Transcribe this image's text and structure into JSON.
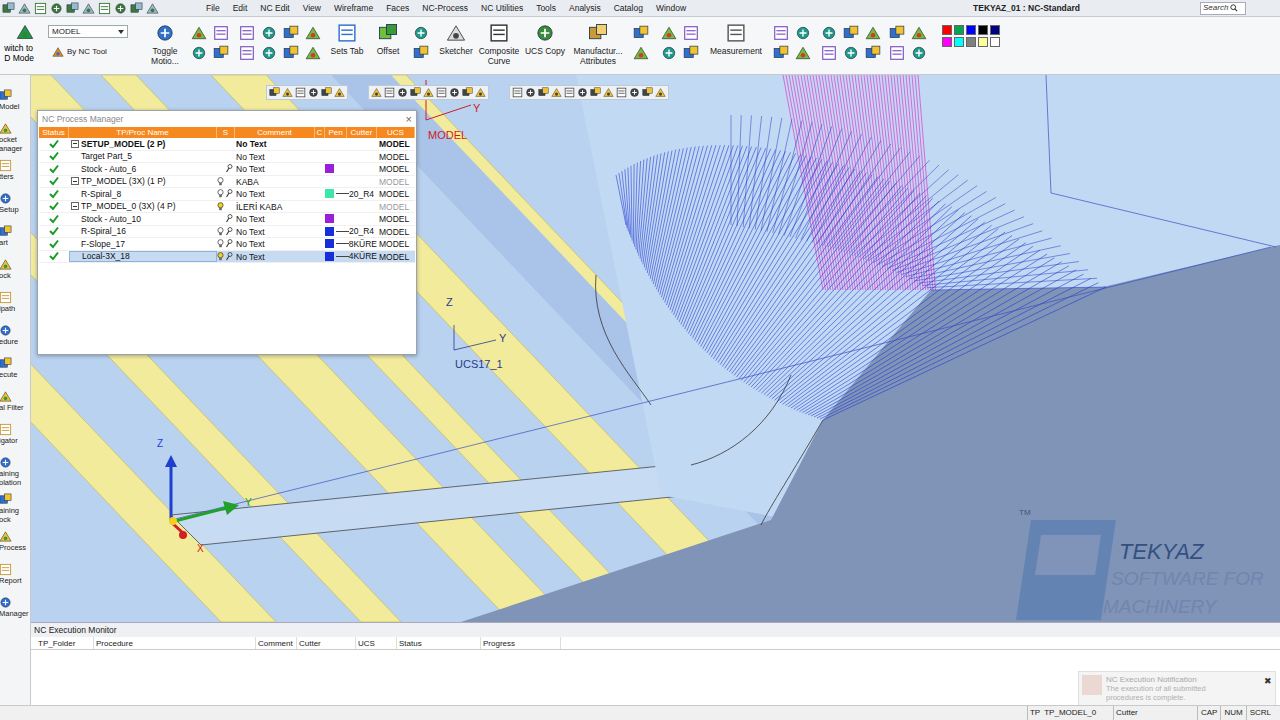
{
  "title_bar": {
    "menu": [
      "File",
      "Edit",
      "NC Edit",
      "View",
      "Wireframe",
      "Faces",
      "NC-Process",
      "NC Utilities",
      "Tools",
      "Analysis",
      "Catalog",
      "Window"
    ],
    "title": "TEKYAZ_01 : NC-Standard",
    "search": {
      "placeholder": "Search"
    }
  },
  "ribbon": {
    "switch_mode": [
      "witch to",
      "D Mode"
    ],
    "model_select": {
      "value": "MODEL"
    },
    "by_nc_tool": "By NC Tool",
    "toggle_motion": [
      "Toggle",
      "Motio..."
    ],
    "sets_tab": [
      "Sets Tab"
    ],
    "offset": [
      "Offset"
    ],
    "sketcher": [
      "Sketcher"
    ],
    "composite_curve": [
      "Composite",
      "Curve"
    ],
    "ucs_copy": [
      "UCS Copy"
    ],
    "manufacturing_attributes": [
      "Manufactur...",
      "Attributes"
    ],
    "measurement": [
      "Measurement"
    ],
    "palette": [
      {
        "color": "#ff0000"
      },
      {
        "color": "#00a651"
      },
      {
        "color": "#0000ff"
      },
      {
        "color": "#000000"
      },
      {
        "color": "#000080"
      },
      {
        "color": "#ff00ff"
      },
      {
        "color": "#00ffff"
      },
      {
        "color": "#808080"
      },
      {
        "color": "#ffff99"
      },
      {
        "color": "#ffffff"
      }
    ]
  },
  "left_toolbar": [
    {
      "lines": [
        "Model"
      ]
    },
    {
      "lines": [
        "ocket",
        "anager"
      ]
    },
    {
      "lines": [
        "tters"
      ]
    },
    {
      "lines": [
        "Setup"
      ]
    },
    {
      "lines": [
        "art"
      ]
    },
    {
      "lines": [
        "ock"
      ]
    },
    {
      "lines": [
        "lpath"
      ]
    },
    {
      "lines": [
        "edure"
      ]
    },
    {
      "lines": [
        "ecute"
      ]
    },
    {
      "lines": [
        "al Filter"
      ]
    },
    {
      "lines": [
        "igator"
      ]
    },
    {
      "lines": [
        "aining",
        "olation"
      ]
    },
    {
      "lines": [
        "aining",
        "ock"
      ]
    },
    {
      "lines": [
        "Process"
      ]
    },
    {
      "lines": [
        "Report"
      ]
    },
    {
      "lines": [
        "Manager"
      ]
    }
  ],
  "process_manager": {
    "title": "NC Process Manager",
    "close": "×",
    "columns": [
      "Status",
      "TP/Proc Name",
      "S",
      "Comment",
      "C",
      "Pen",
      "Cutter",
      "UCS"
    ],
    "rows": [
      {
        "name": "SETUP_MODEL (2 P)",
        "folder": true,
        "expanded": true,
        "bold": true,
        "greyed": false,
        "lamp": false,
        "lamp_lit": false,
        "wrench": false,
        "comment": "No Text",
        "color": "",
        "cutter": "",
        "ucs": "MODEL",
        "selected": false
      },
      {
        "name": "Target Part_5",
        "folder": false,
        "expanded": false,
        "bold": false,
        "greyed": false,
        "lamp": false,
        "lamp_lit": false,
        "wrench": false,
        "comment": "No Text",
        "color": "",
        "cutter": "",
        "ucs": "MODEL",
        "selected": false
      },
      {
        "name": "Stock - Auto_6",
        "folder": false,
        "expanded": false,
        "bold": false,
        "greyed": false,
        "lamp": false,
        "lamp_lit": false,
        "wrench": true,
        "comment": "No Text",
        "color": "#9b1fd6",
        "cutter": "",
        "ucs": "MODEL",
        "selected": false
      },
      {
        "name": "TP_MODEL (3X) (1 P)",
        "folder": true,
        "expanded": true,
        "bold": false,
        "greyed": true,
        "lamp": true,
        "lamp_lit": false,
        "wrench": false,
        "comment": "KABA",
        "color": "",
        "cutter": "",
        "ucs": "MODEL",
        "selected": false
      },
      {
        "name": "R-Spiral_8",
        "folder": false,
        "expanded": false,
        "bold": false,
        "greyed": false,
        "lamp": true,
        "lamp_lit": false,
        "wrench": true,
        "comment": "No Text",
        "color": "#3ee6a8",
        "cutter": "20_R4",
        "ucs": "MODEL",
        "selected": false
      },
      {
        "name": "TP_MODEL_0 (3X) (4 P)",
        "folder": true,
        "expanded": true,
        "bold": false,
        "greyed": true,
        "lamp": true,
        "lamp_lit": true,
        "wrench": false,
        "comment": "İLERİ KABA",
        "color": "",
        "cutter": "",
        "ucs": "MODEL",
        "selected": false
      },
      {
        "name": "Stock - Auto_10",
        "folder": false,
        "expanded": false,
        "bold": false,
        "greyed": false,
        "lamp": false,
        "lamp_lit": false,
        "wrench": true,
        "comment": "No Text",
        "color": "#9b1fd6",
        "cutter": "",
        "ucs": "MODEL",
        "selected": false
      },
      {
        "name": "R-Spiral_16",
        "folder": false,
        "expanded": false,
        "bold": false,
        "greyed": false,
        "lamp": true,
        "lamp_lit": false,
        "wrench": true,
        "comment": "No Text",
        "color": "#1530d8",
        "cutter": "20_R4",
        "ucs": "MODEL",
        "selected": false
      },
      {
        "name": "F-Slope_17",
        "folder": false,
        "expanded": false,
        "bold": false,
        "greyed": false,
        "lamp": true,
        "lamp_lit": false,
        "wrench": true,
        "comment": "No Text",
        "color": "#1530d8",
        "cutter": "8KÜRE",
        "ucs": "MODEL",
        "selected": false
      },
      {
        "name": "Local-3X_18",
        "folder": false,
        "expanded": false,
        "bold": false,
        "greyed": false,
        "lamp": true,
        "lamp_lit": true,
        "wrench": true,
        "comment": "No Text",
        "color": "#1530d8",
        "cutter": "4KÜRE",
        "ucs": "MODEL",
        "selected": true
      }
    ]
  },
  "viewport": {
    "model_label": "MODEL",
    "model_axis_y": "Y",
    "ucs_label": "UCS17_1",
    "ucs_axis_z": "Z",
    "ucs_axis_y": "Y",
    "triad_z": "Z",
    "triad_y": "Y",
    "triad_x": "X",
    "watermark": {
      "tm": "TM",
      "name": "TEKYAZ",
      "line1": "SOFTWARE FOR",
      "line2": "MACHINERY"
    }
  },
  "execution_monitor": {
    "title": "NC Execution Monitor",
    "columns": [
      "TP_Folder",
      "Procedure",
      "Comment",
      "Cutter",
      "UCS",
      "Status",
      "Progress"
    ]
  },
  "notification": {
    "title": "NC Execution Notification",
    "lines": [
      "The execution of all submitted",
      "procedures is complete."
    ],
    "close": "✖"
  },
  "status_bar": {
    "folder_prefix": "TP",
    "folder": "TP_MODEL_0",
    "cutter": "Cutter",
    "indicators": [
      "CAP",
      "NUM",
      "SCRL"
    ]
  }
}
